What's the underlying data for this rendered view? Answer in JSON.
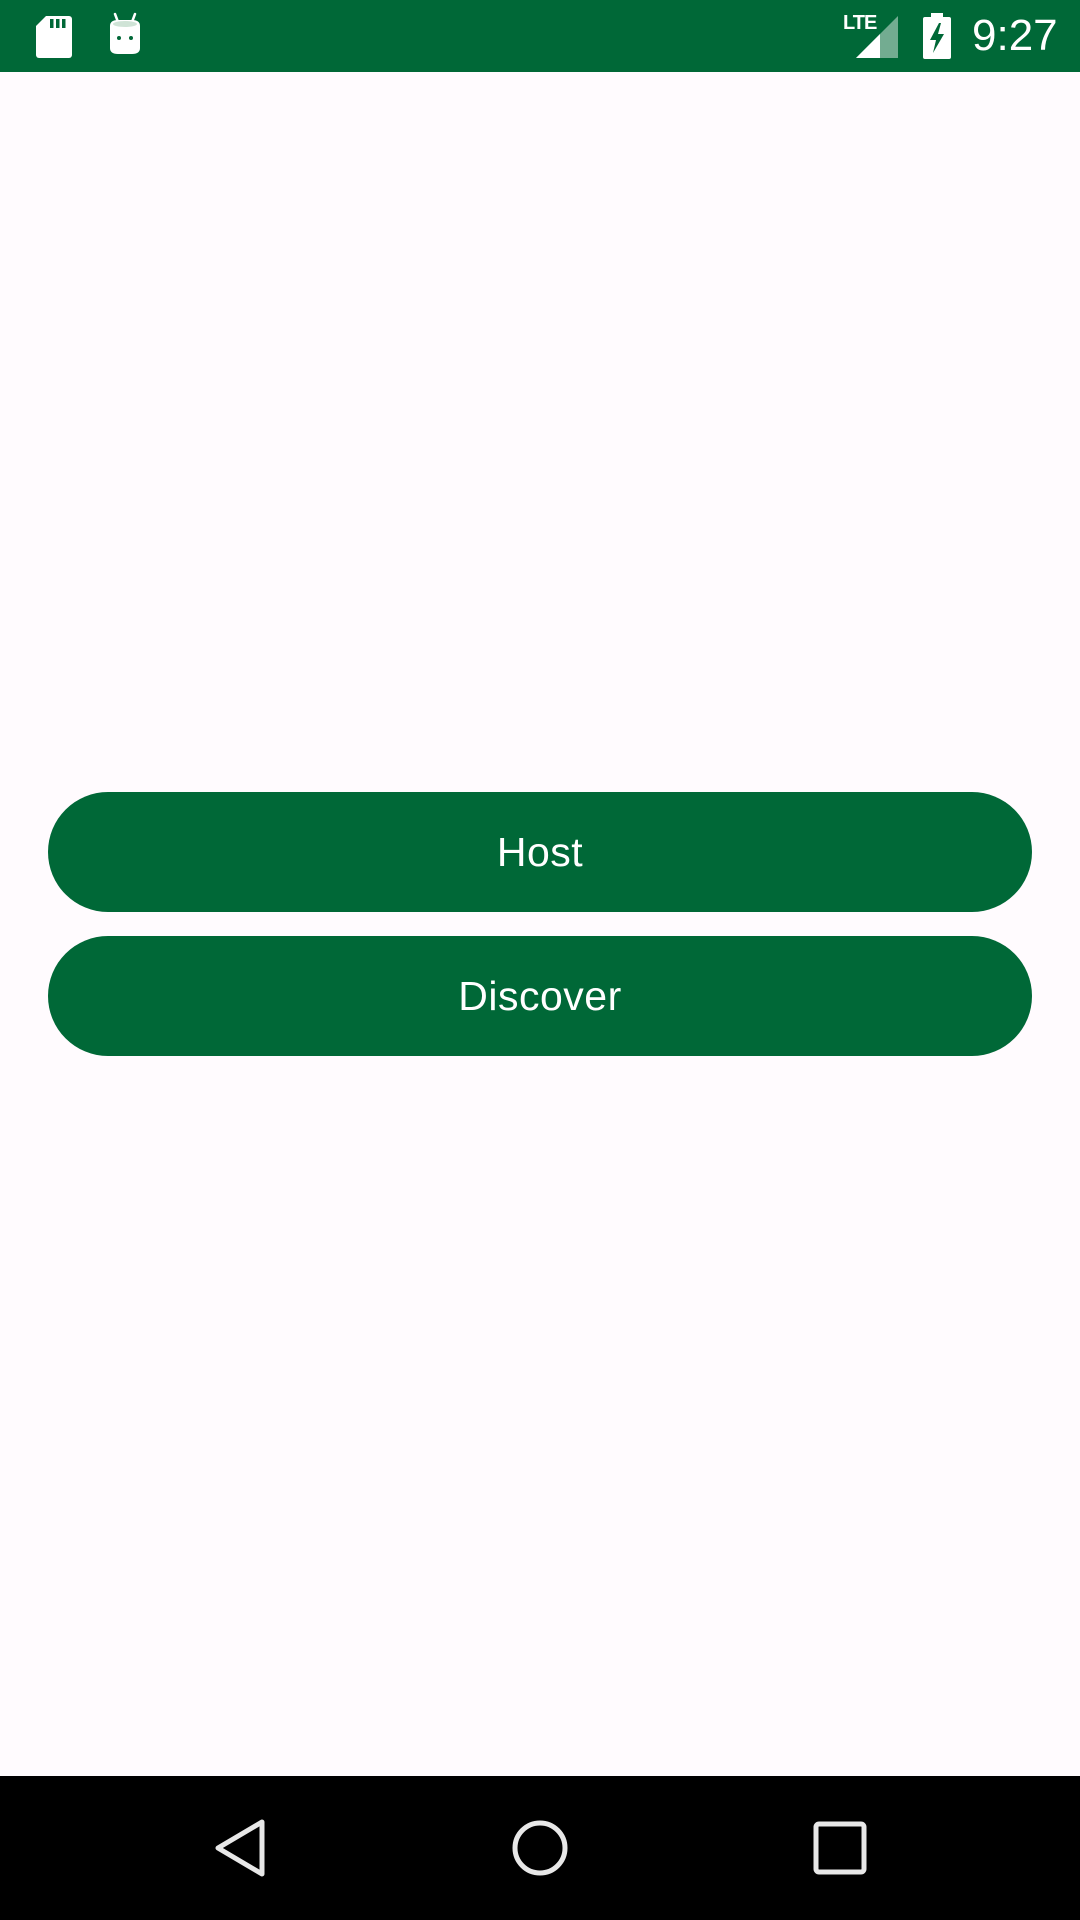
{
  "status_bar": {
    "network": "LTE",
    "time": "9:27",
    "icons": [
      "sd-card-icon",
      "android-robot-icon",
      "signal-icon",
      "battery-charging-icon"
    ]
  },
  "main": {
    "buttons": [
      {
        "label": "Host"
      },
      {
        "label": "Discover"
      }
    ]
  },
  "nav_bar": {
    "icons": [
      "back-icon",
      "home-icon",
      "recents-icon"
    ]
  },
  "colors": {
    "primary": "#006837",
    "background": "#fffbfe",
    "nav_background": "#000000",
    "on_primary": "#ffffff"
  }
}
